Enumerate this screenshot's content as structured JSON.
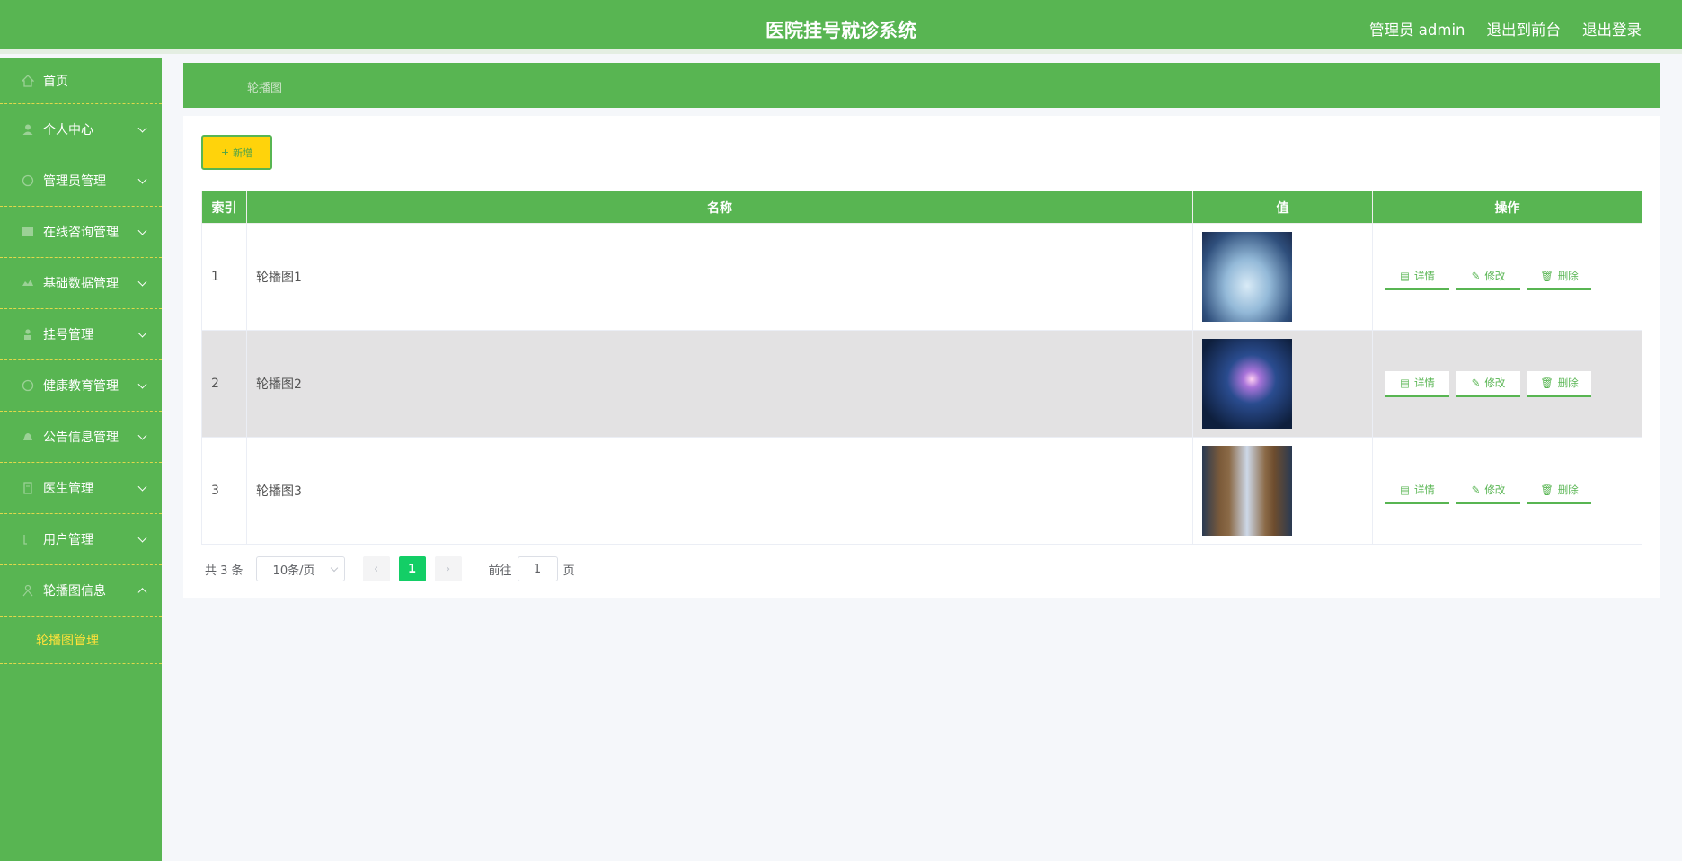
{
  "header": {
    "title": "医院挂号就诊系统",
    "user_label": "管理员 admin",
    "to_front_label": "退出到前台",
    "logout_label": "退出登录"
  },
  "sidebar": {
    "items": [
      {
        "label": "首页",
        "icon": "home-icon",
        "has_children": false
      },
      {
        "label": "个人中心",
        "icon": "user-icon",
        "has_children": true
      },
      {
        "label": "管理员管理",
        "icon": "circle-icon",
        "has_children": true
      },
      {
        "label": "在线咨询管理",
        "icon": "grid-icon",
        "has_children": true
      },
      {
        "label": "基础数据管理",
        "icon": "database-icon",
        "has_children": true
      },
      {
        "label": "挂号管理",
        "icon": "person-icon",
        "has_children": true
      },
      {
        "label": "健康教育管理",
        "icon": "circle-icon",
        "has_children": true
      },
      {
        "label": "公告信息管理",
        "icon": "bell-icon",
        "has_children": true
      },
      {
        "label": "医生管理",
        "icon": "doctor-icon",
        "has_children": true
      },
      {
        "label": "用户管理",
        "icon": "users-icon",
        "has_children": true
      },
      {
        "label": "轮播图信息",
        "icon": "image-icon",
        "has_children": true,
        "expanded": true
      }
    ],
    "submenu": {
      "label": "轮播图管理"
    }
  },
  "breadcrumb": {
    "current": "轮播图"
  },
  "toolbar": {
    "add_label": "新增",
    "add_icon": "plus-icon"
  },
  "table": {
    "columns": [
      "索引",
      "名称",
      "值",
      "操作"
    ],
    "rows": [
      {
        "index": "1",
        "name": "轮播图1",
        "image": "blue-landscape-thumbnail"
      },
      {
        "index": "2",
        "name": "轮播图2",
        "image": "glowing-night-thumbnail"
      },
      {
        "index": "3",
        "name": "轮播图3",
        "image": "tree-trunk-thumbnail"
      }
    ],
    "actions": {
      "detail": "详情",
      "edit": "修改",
      "delete": "删除"
    }
  },
  "pagination": {
    "total_label": "共 3 条",
    "page_size_label": "10条/页",
    "current_page": "1",
    "goto_label": "前往",
    "goto_value": "1",
    "page_suffix": "页"
  },
  "colors": {
    "primary": "#58b552",
    "accent_yellow": "#ffd30b",
    "active_page": "#13ce66"
  }
}
